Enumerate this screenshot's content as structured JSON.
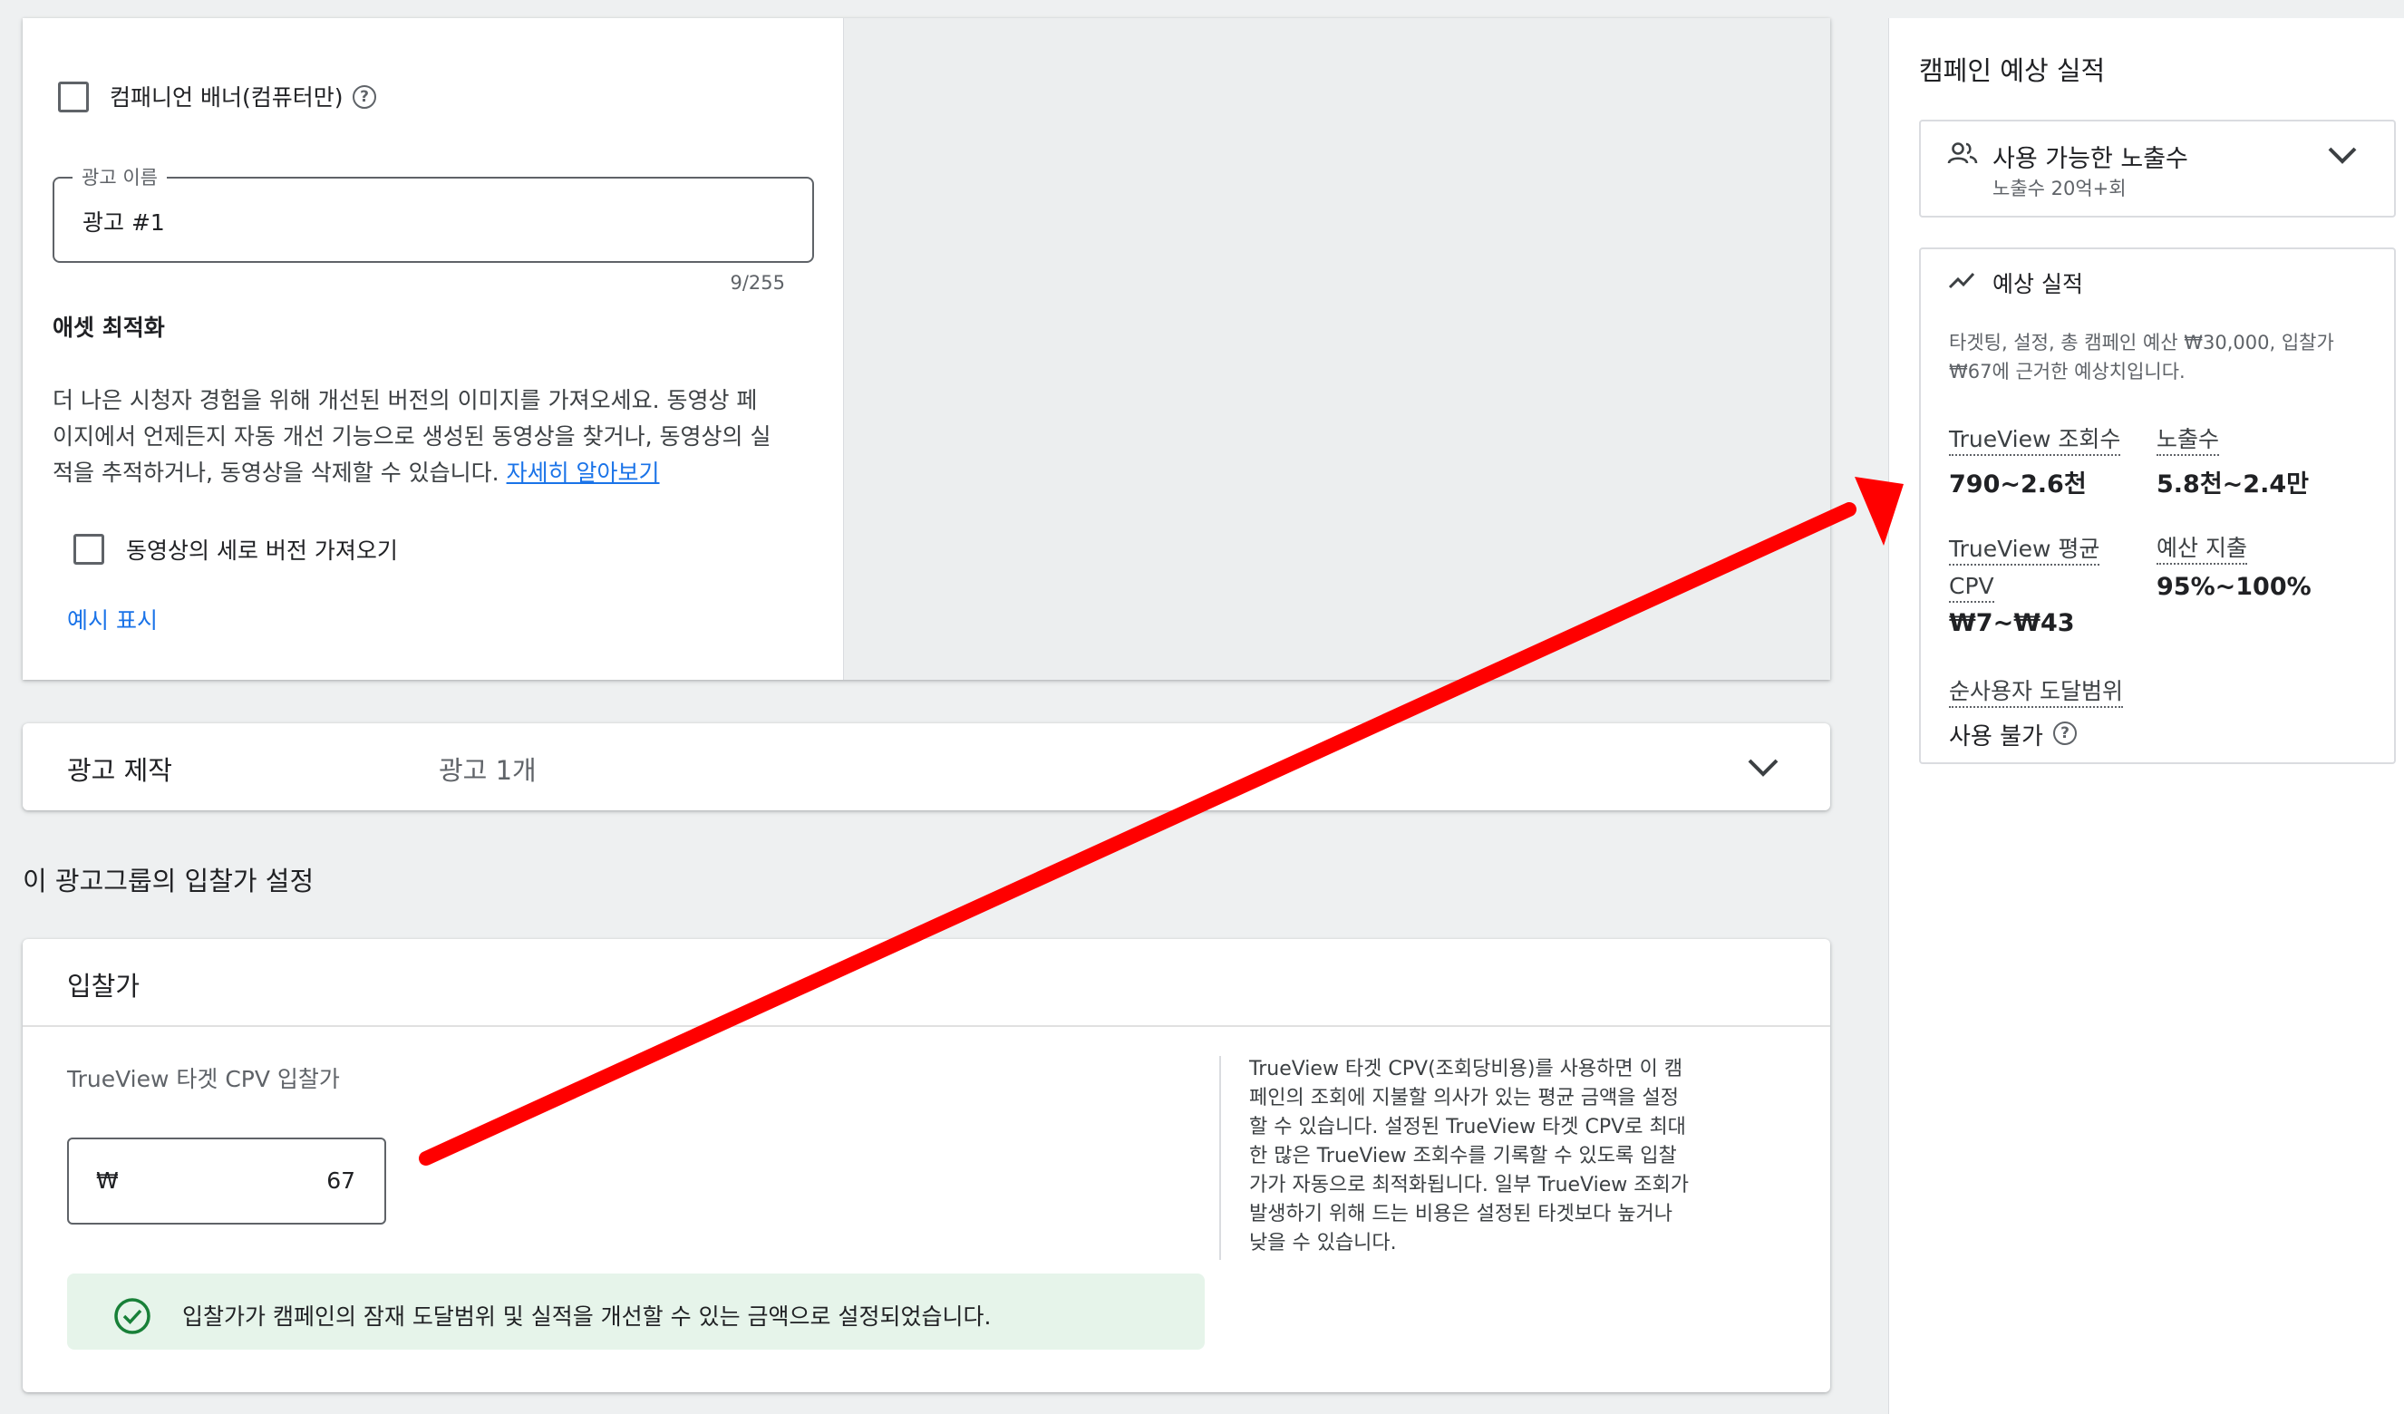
{
  "ad_section": {
    "companion_banner_label": "컴패니언 배너(컴퓨터만)",
    "ad_name": {
      "label": "광고 이름",
      "value": "광고 #1",
      "char_count": "9/255"
    },
    "asset_optimization": {
      "title": "애셋 최적화",
      "description_line1": "더 나은 시청자 경험을 위해 개선된 버전의 이미지를 가져오세요. 동영상 페",
      "description_line2": "이지에서 언제든지 자동 개선 기능으로 생성된 동영상을 찾거나, 동영상의 실",
      "description_line3": "적을 추적하거나, 동영상을 삭제할 수 있습니다. ",
      "learn_more": "자세히 알아보기",
      "vertical_checkbox_label": "동영상의 세로 버전 가져오기",
      "show_example": "예시 표시"
    }
  },
  "ad_creation": {
    "title": "광고 제작",
    "summary": "광고 1개"
  },
  "bid_settings": {
    "heading": "이 광고그룹의 입찰가 설정",
    "card_title": "입찰가",
    "field_label": "TrueView 타겟 CPV 입찰가",
    "currency_symbol": "₩",
    "bid_value": "67",
    "help_lines": [
      "TrueView 타겟 CPV(조회당비용)를 사용하면 이 캠",
      "페인의 조회에 지불할 의사가 있는 평균 금액을 설정",
      "할 수 있습니다. 설정된 TrueView 타겟 CPV로 최대",
      "한 많은 TrueView 조회수를 기록할 수 있도록 입찰",
      "가가 자동으로 최적화됩니다. 일부 TrueView 조회가",
      "발생하기 위해 드는 비용은 설정된 타겟보다 높거나",
      "낮을 수 있습니다."
    ],
    "success_message": "입찰가가 캠페인의 잠재 도달범위 및 실적을 개선할 수 있는 금액으로 설정되었습니다."
  },
  "sidebar": {
    "title": "캠페인 예상 실적",
    "available_impressions": {
      "title": "사용 가능한 노출수",
      "subtitle": "노출수 20억+회"
    },
    "estimates": {
      "title": "예상 실적",
      "description_line1": "타겟팅, 설정, 총 캠페인 예산 ₩30,000, 입찰가",
      "description_line2": "₩67에 근거한 예상치입니다.",
      "trueview_views_label": "TrueView 조회수",
      "trueview_views_value": "790~2.6천",
      "impressions_label": "노출수",
      "impressions_value": "5.8천~2.4만",
      "avg_cpv_label_line1": "TrueView 평균",
      "avg_cpv_label_line2": "CPV",
      "avg_cpv_value": "₩7~₩43",
      "budget_spend_label": "예산 지출",
      "budget_spend_value": "95%~100%",
      "unique_reach_label": "순사용자 도달범위",
      "unique_reach_value": "사용 불가"
    }
  },
  "colors": {
    "accent_blue": "#1a73e8",
    "success_green": "#188038",
    "success_bg": "#e6f4ea",
    "annotation_arrow": "#ff0000"
  },
  "icons": {
    "help": "question-circle-icon",
    "chevron": "chevron-down-icon",
    "people": "people-icon",
    "trend": "trending-up-icon",
    "success": "check-circle-icon"
  }
}
